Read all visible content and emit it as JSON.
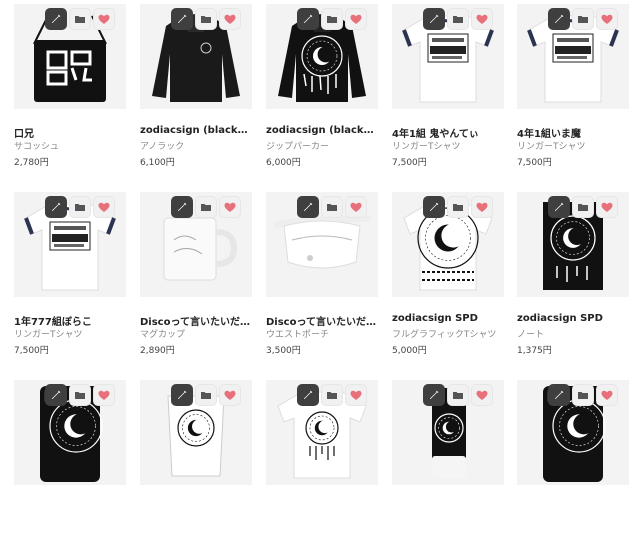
{
  "colors": {
    "heart": "#e8707a",
    "edit_bg": "#3f3f3f",
    "price": "#444444"
  },
  "icons": {
    "edit": "pencil-icon",
    "folder": "folder-icon",
    "favorite": "heart-icon"
  },
  "products": [
    {
      "title": "口兄",
      "type": "サコッシュ",
      "price": "2,780円",
      "image": "sacoche"
    },
    {
      "title": "zodiacsign (blackb…",
      "type": "アノラック",
      "price": "6,100円",
      "image": "anorak"
    },
    {
      "title": "zodiacsign (blackb…",
      "type": "ジップパーカー",
      "price": "6,000円",
      "image": "zip-hoodie"
    },
    {
      "title": "4年1組 鬼やんてぃ",
      "type": "リンガーTシャツ",
      "price": "7,500円",
      "image": "ringer-tshirt"
    },
    {
      "title": "4年1組いま魔",
      "type": "リンガーTシャツ",
      "price": "7,500円",
      "image": "ringer-tshirt"
    },
    {
      "title": "1年777組ぼらこ",
      "type": "リンガーTシャツ",
      "price": "7,500円",
      "image": "ringer-tshirt"
    },
    {
      "title": "Discoって言いたいだ…",
      "type": "マグカップ",
      "price": "2,890円",
      "image": "mug"
    },
    {
      "title": "Discoって言いたいだ…",
      "type": "ウエストポーチ",
      "price": "3,500円",
      "image": "waist-pouch"
    },
    {
      "title": "zodiacsign SPD",
      "type": "フルグラフィックTシャツ",
      "price": "5,000円",
      "image": "full-graphic-tshirt"
    },
    {
      "title": "zodiacsign SPD",
      "type": "ノート",
      "price": "1,375円",
      "image": "notebook"
    },
    {
      "title": "",
      "type": "",
      "price": "",
      "image": "phone-case-black"
    },
    {
      "title": "",
      "type": "",
      "price": "",
      "image": "cup-holder"
    },
    {
      "title": "",
      "type": "",
      "price": "",
      "image": "tshirt-white"
    },
    {
      "title": "",
      "type": "",
      "price": "",
      "image": "phone-case-white"
    },
    {
      "title": "",
      "type": "",
      "price": "",
      "image": "phone-case-black"
    }
  ]
}
